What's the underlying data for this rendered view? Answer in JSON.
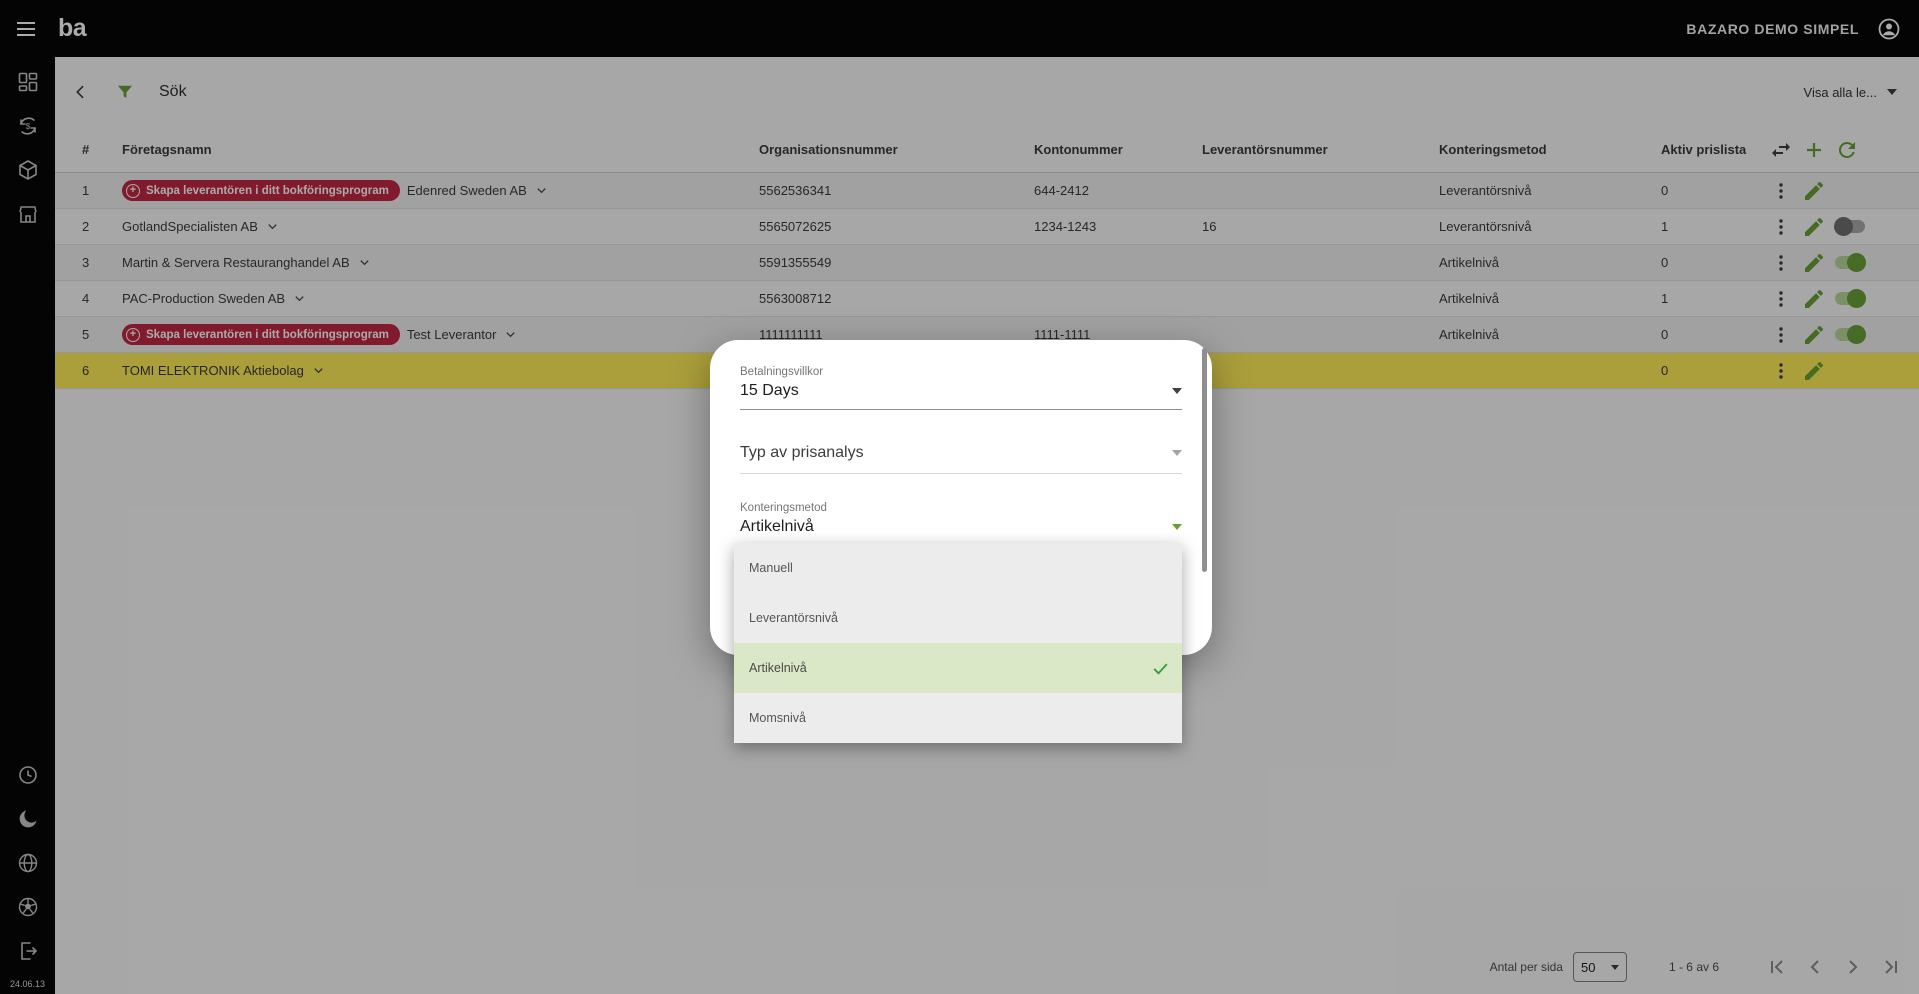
{
  "topbar": {
    "brand": "ba",
    "account": "BAZARO DEMO SIMPEL"
  },
  "sidebar": {
    "version": "24.06.13"
  },
  "toolbar": {
    "search": "Sök",
    "show_all": "Visa alla le..."
  },
  "table": {
    "headers": {
      "num": "#",
      "name": "Företagsnamn",
      "org": "Organisationsnummer",
      "account": "Kontonummer",
      "supplier_no": "Leverantörsnummer",
      "method": "Konteringsmetod",
      "active_pricelist": "Aktiv prislista"
    },
    "rows": [
      {
        "num": "1",
        "badge": "Skapa leverantören i ditt bokföringsprogram",
        "name": "Edenred Sweden AB",
        "org": "5562536341",
        "account": "644-2412",
        "supplier_no": "",
        "method": "Leverantörsnivå",
        "active": "0",
        "toggle_state": "none",
        "selected": false
      },
      {
        "num": "2",
        "badge": "",
        "name": "GotlandSpecialisten AB",
        "org": "5565072625",
        "account": "1234-1243",
        "supplier_no": "16",
        "method": "Leverantörsnivå",
        "active": "1",
        "toggle_state": "off",
        "selected": false
      },
      {
        "num": "3",
        "badge": "",
        "name": "Martin & Servera Restauranghandel AB",
        "org": "5591355549",
        "account": "",
        "supplier_no": "",
        "method": "Artikelnivå",
        "active": "0",
        "toggle_state": "on",
        "selected": false
      },
      {
        "num": "4",
        "badge": "",
        "name": "PAC-Production Sweden AB",
        "org": "5563008712",
        "account": "",
        "supplier_no": "",
        "method": "Artikelnivå",
        "active": "1",
        "toggle_state": "on",
        "selected": false
      },
      {
        "num": "5",
        "badge": "Skapa leverantören i ditt bokföringsprogram",
        "name": "Test Leverantor",
        "org": "1111111111",
        "account": "1111-1111",
        "supplier_no": "",
        "method": "Artikelnivå",
        "active": "0",
        "toggle_state": "on",
        "selected": false
      },
      {
        "num": "6",
        "badge": "",
        "name": "TOMI ELEKTRONIK Aktiebolag",
        "org": "",
        "account": "",
        "supplier_no": "",
        "method": "",
        "active": "0",
        "toggle_state": "none",
        "selected": true
      }
    ]
  },
  "modal": {
    "payment_terms_label": "Betalningsvillkor",
    "payment_terms_value": "15 Days",
    "price_analysis_placeholder": "Typ av prisanalys",
    "accounting_method_label": "Konteringsmetod",
    "accounting_method_value": "Artikelnivå",
    "options": [
      "Manuell",
      "Leverantörsnivå",
      "Artikelnivå",
      "Momsnivå"
    ],
    "selected_option": "Artikelnivå"
  },
  "pagination": {
    "per_page_label": "Antal per sida",
    "per_page": "50",
    "range": "1 - 6 av 6"
  },
  "colors": {
    "accent_green": "#67a036",
    "badge_red": "#c02742",
    "selected_row_yellow": "#ffee58"
  }
}
